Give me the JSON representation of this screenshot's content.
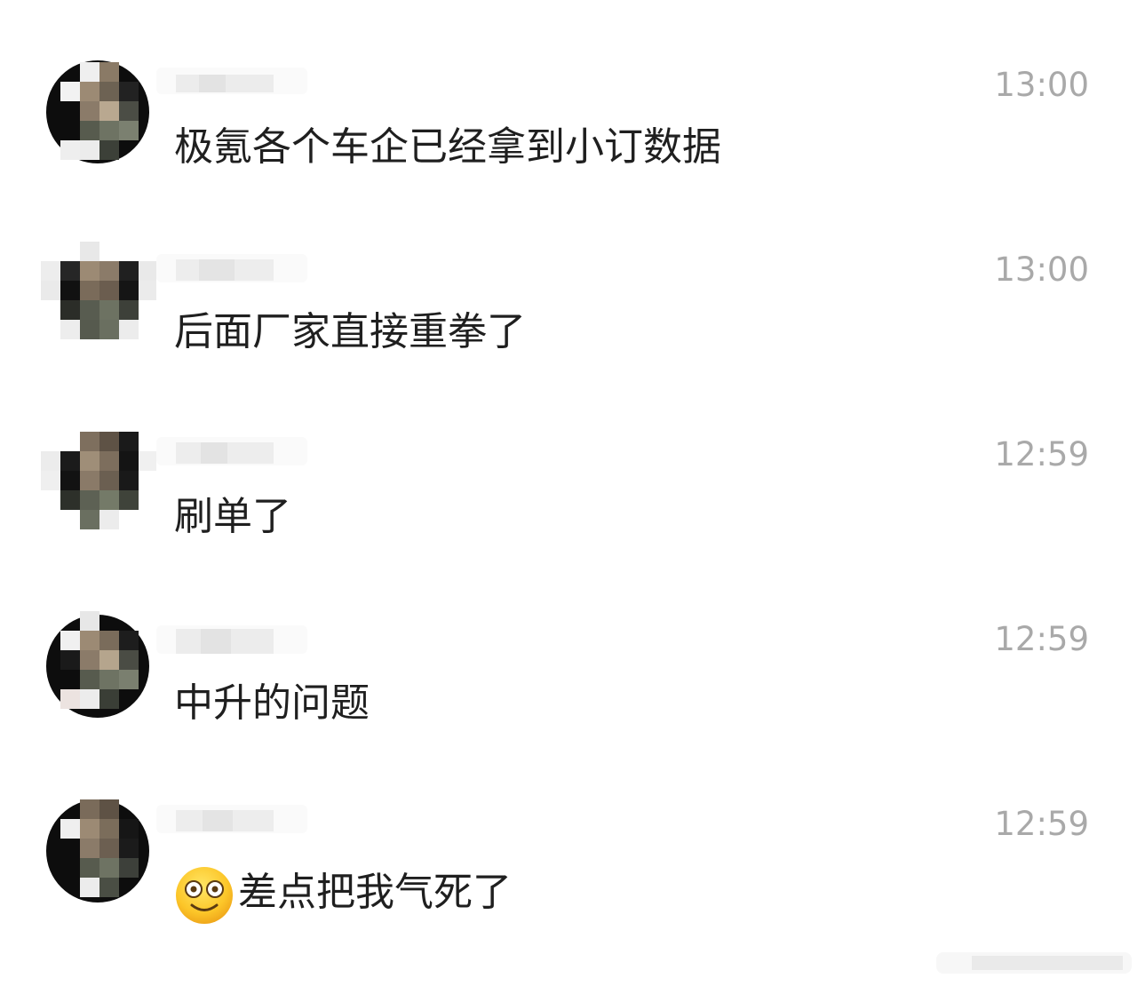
{
  "messages": [
    {
      "time": "13:00",
      "text": "极氪各个车企已经拿到小订数据",
      "emoji": ""
    },
    {
      "time": "13:00",
      "text": "后面厂家直接重拳了",
      "emoji": ""
    },
    {
      "time": "12:59",
      "text": "刷单了",
      "emoji": ""
    },
    {
      "time": "12:59",
      "text": "中升的问题",
      "emoji": ""
    },
    {
      "time": "12:59",
      "text": "差点把我气死了",
      "emoji": "dizzy-smile-emoji"
    }
  ],
  "colors": {
    "message_text": "#1f1f1f",
    "timestamp": "#a9a9a9",
    "background": "#ffffff"
  }
}
